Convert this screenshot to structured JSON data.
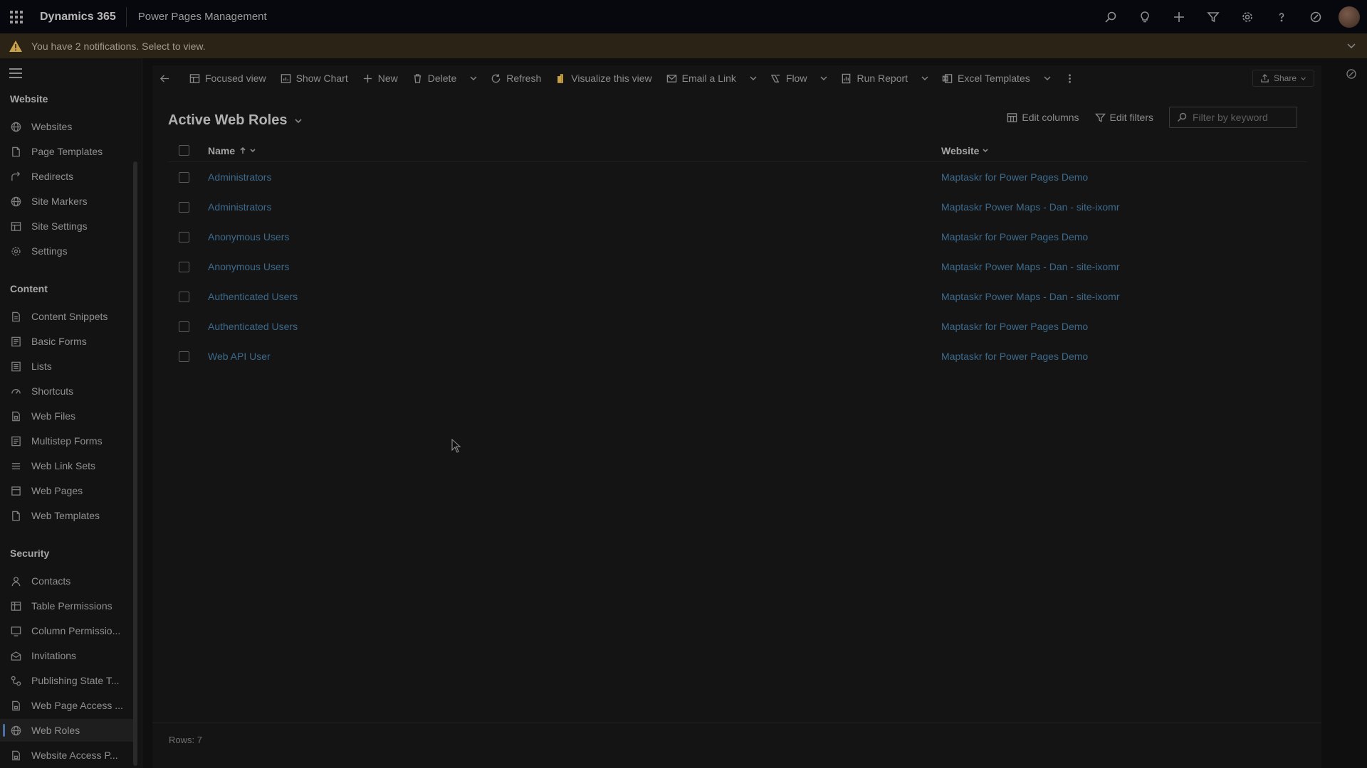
{
  "topbar": {
    "brand": "Dynamics 365",
    "app_name": "Power Pages Management",
    "icons": [
      "search-icon",
      "lightbulb-icon",
      "plus-icon",
      "filter-icon",
      "gear-icon",
      "help-icon",
      "copilot-icon",
      "avatar"
    ]
  },
  "notification": {
    "text": "You have 2 notifications. Select to view."
  },
  "sidebar": {
    "sections": [
      {
        "title": "Website",
        "items": [
          {
            "label": "Websites",
            "icon": "globe-icon"
          },
          {
            "label": "Page Templates",
            "icon": "page-icon"
          },
          {
            "label": "Redirects",
            "icon": "redirect-icon"
          },
          {
            "label": "Site Markers",
            "icon": "globe-icon"
          },
          {
            "label": "Site Settings",
            "icon": "settings-grid-icon"
          },
          {
            "label": "Settings",
            "icon": "gear-icon"
          }
        ]
      },
      {
        "title": "Content",
        "items": [
          {
            "label": "Content Snippets",
            "icon": "snippet-icon"
          },
          {
            "label": "Basic Forms",
            "icon": "form-icon"
          },
          {
            "label": "Lists",
            "icon": "list-icon"
          },
          {
            "label": "Shortcuts",
            "icon": "shortcut-icon"
          },
          {
            "label": "Web Files",
            "icon": "file-icon"
          },
          {
            "label": "Multistep Forms",
            "icon": "form-icon"
          },
          {
            "label": "Web Link Sets",
            "icon": "list-icon"
          },
          {
            "label": "Web Pages",
            "icon": "page-icon"
          },
          {
            "label": "Web Templates",
            "icon": "page-icon"
          }
        ]
      },
      {
        "title": "Security",
        "items": [
          {
            "label": "Contacts",
            "icon": "person-icon"
          },
          {
            "label": "Table Permissions",
            "icon": "table-icon"
          },
          {
            "label": "Column Permissio...",
            "icon": "column-icon"
          },
          {
            "label": "Invitations",
            "icon": "invitation-icon"
          },
          {
            "label": "Publishing State T...",
            "icon": "flow-icon"
          },
          {
            "label": "Web Page Access ...",
            "icon": "page-lock-icon"
          },
          {
            "label": "Web Roles",
            "icon": "roles-icon",
            "active": true
          },
          {
            "label": "Website Access P...",
            "icon": "page-lock-icon"
          }
        ]
      }
    ]
  },
  "commandbar": {
    "back": "back-icon",
    "focused_view": "Focused view",
    "show_chart": "Show Chart",
    "new": "New",
    "delete": "Delete",
    "refresh": "Refresh",
    "visualize": "Visualize this view",
    "email_link": "Email a Link",
    "flow": "Flow",
    "run_report": "Run Report",
    "excel_templates": "Excel Templates",
    "share": "Share"
  },
  "view": {
    "title": "Active Web Roles",
    "edit_columns": "Edit columns",
    "edit_filters": "Edit filters",
    "filter_placeholder": "Filter by keyword"
  },
  "grid": {
    "columns": {
      "name": "Name",
      "website": "Website"
    },
    "rows": [
      {
        "name": "Administrators",
        "website": "Maptaskr for Power Pages Demo"
      },
      {
        "name": "Administrators",
        "website": "Maptaskr Power Maps - Dan - site-ixomr"
      },
      {
        "name": "Anonymous Users",
        "website": "Maptaskr for Power Pages Demo"
      },
      {
        "name": "Anonymous Users",
        "website": "Maptaskr Power Maps - Dan - site-ixomr"
      },
      {
        "name": "Authenticated Users",
        "website": "Maptaskr Power Maps - Dan - site-ixomr"
      },
      {
        "name": "Authenticated Users",
        "website": "Maptaskr for Power Pages Demo"
      },
      {
        "name": "Web API User",
        "website": "Maptaskr for Power Pages Demo"
      }
    ],
    "rows_count": "Rows: 7"
  }
}
